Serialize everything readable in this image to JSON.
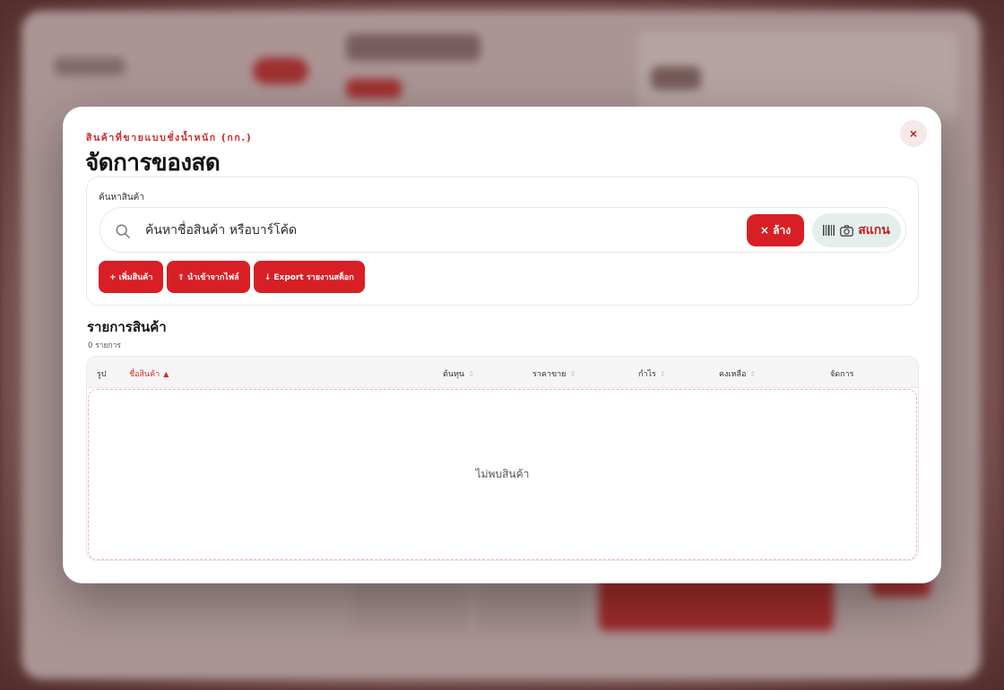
{
  "modal": {
    "eyebrow": "สินค้าที่ขายแบบชั่งน้ำหนัก (กก.)",
    "title": "จัดการของสด",
    "close_label": "×"
  },
  "search": {
    "label": "ค้นหาสินค้า",
    "placeholder": "ค้นหาชื่อสินค้า หรือบาร์โค้ด",
    "value": "",
    "clear_label": "× ล้าง",
    "scan_label": "สแกน"
  },
  "actions": {
    "add_label": "+ เพิ่มสินค้า",
    "import_label": "⇧ นำเข้าจากไฟล์",
    "export_label": "↓ Export รายงานสต็อก"
  },
  "list": {
    "title": "รายการสินค้า",
    "count": "0 รายการ",
    "columns": [
      {
        "label": "รูป",
        "sort": ""
      },
      {
        "label": "ชื่อสินค้า",
        "sort": "▲"
      },
      {
        "label": "ต้นทุน",
        "sort": "⇕"
      },
      {
        "label": "ราคาขาย",
        "sort": "⇕"
      },
      {
        "label": "กำไร",
        "sort": "⇕"
      },
      {
        "label": "คงเหลือ",
        "sort": "⇕"
      },
      {
        "label": "จัดการ",
        "sort": ""
      }
    ],
    "empty_text": "ไม่พบสินค้า"
  },
  "colors": {
    "accent": "#d81f26",
    "accent_text": "#cf2a2a",
    "scan_bg": "#e4efed"
  },
  "icons": {
    "search": "search-icon",
    "barcode": "barcode-icon",
    "camera": "camera-icon",
    "close": "close-icon"
  }
}
